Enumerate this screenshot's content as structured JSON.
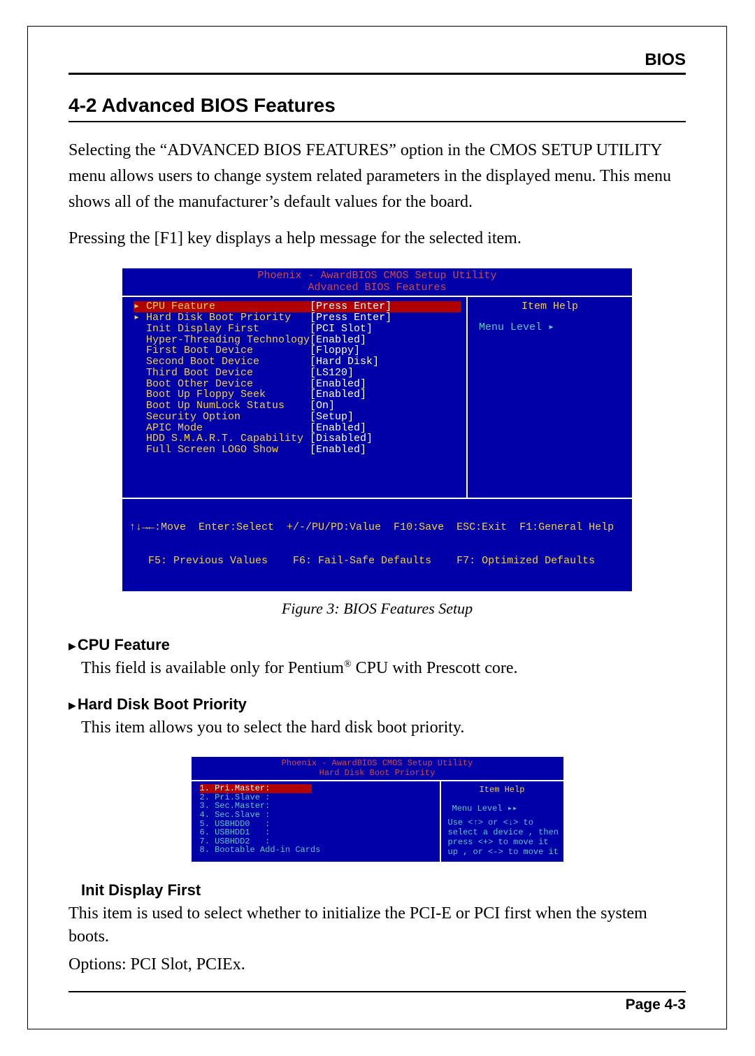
{
  "header": {
    "label": "BIOS"
  },
  "section": {
    "title": "4-2 Advanced BIOS Features"
  },
  "intro": {
    "p1": "Selecting the “ADVANCED BIOS FEATURES” option in the CMOS SETUP UTILITY menu allows users to change system related parameters in the displayed menu. This menu shows all  of the manufacturer’s default values for the board.",
    "p2": "Pressing the [F1] key displays a help message for the selected item."
  },
  "bios1": {
    "title": "Phoenix - AwardBIOS CMOS Setup Utility",
    "subtitle": "Advanced BIOS Features",
    "rows": [
      {
        "pre": "▸ ",
        "label": "CPU Feature",
        "value": "[Press Enter]",
        "selected": true
      },
      {
        "pre": "▸ ",
        "label": "Hard Disk Boot Priority",
        "value": "[Press Enter]"
      },
      {
        "pre": "  ",
        "label": "Init Display First",
        "value": "[PCI Slot]"
      },
      {
        "pre": "  ",
        "label": "Hyper-Threading Technology",
        "value": "[Enabled]"
      },
      {
        "pre": "  ",
        "label": "First Boot Device",
        "value": "[Floppy]"
      },
      {
        "pre": "  ",
        "label": "Second Boot Device",
        "value": "[Hard Disk]"
      },
      {
        "pre": "  ",
        "label": "Third Boot Device",
        "value": "[LS120]"
      },
      {
        "pre": "  ",
        "label": "Boot Other Device",
        "value": "[Enabled]"
      },
      {
        "pre": "  ",
        "label": "Boot Up Floppy Seek",
        "value": "[Enabled]"
      },
      {
        "pre": "  ",
        "label": "Boot Up NumLock Status",
        "value": "[On]"
      },
      {
        "pre": "  ",
        "label": "Security Option",
        "value": "[Setup]"
      },
      {
        "pre": "  ",
        "label": "APIC Mode",
        "value": "[Enabled]"
      },
      {
        "pre": "  ",
        "label": "HDD S.M.A.R.T. Capability",
        "value": "[Disabled]"
      },
      {
        "pre": "  ",
        "label": "Full Screen LOGO Show",
        "value": "[Enabled]"
      }
    ],
    "right": {
      "item_help": "Item Help",
      "menu_level": "Menu Level   ▸"
    },
    "footer": {
      "l1": "↑↓→←:Move  Enter:Select  +/-/PU/PD:Value  F10:Save  ESC:Exit  F1:General Help",
      "l2": "   F5: Previous Values    F6: Fail-Safe Defaults    F7: Optimized Defaults"
    }
  },
  "figure": {
    "caption": "Figure 3:  BIOS Features Setup"
  },
  "items": {
    "cpu_feature": {
      "title": "CPU Feature",
      "text_pre": "This field is available only for Pentium",
      "text_post": " CPU with Prescott core."
    },
    "hd_boot": {
      "title": "Hard Disk Boot Priority",
      "text": "This item allows you to select the hard disk boot priority."
    },
    "init_display": {
      "title": "Init Display First",
      "text": "This item is used to select whether to initialize the PCI-E or PCI first when the system boots.",
      "options": "Options: PCI Slot, PCIEx."
    }
  },
  "bios2": {
    "title": "Phoenix - AwardBIOS CMOS Setup Utility",
    "subtitle": "Hard Disk Boot Priority",
    "rows": [
      {
        "n": "1.",
        "label": "Pri.Master:",
        "selected": true
      },
      {
        "n": "2.",
        "label": "Pri.Slave :"
      },
      {
        "n": "3.",
        "label": "Sec.Master:"
      },
      {
        "n": "4.",
        "label": "Sec.Slave :"
      },
      {
        "n": "5.",
        "label": "USBHDD0   :"
      },
      {
        "n": "6.",
        "label": "USBHDD1   :"
      },
      {
        "n": "7.",
        "label": "USBHDD2   :"
      },
      {
        "n": "8.",
        "label": "Bootable Add-in Cards"
      }
    ],
    "right": {
      "item_help": "Item Help",
      "menu_level": "Menu Level   ▸▸",
      "help": "Use <↑> or <↓> to\nselect a device , then\npress <+> to move it\nup , or <-> to move it"
    }
  },
  "footer": {
    "page": "Page 4-3"
  },
  "glyphs": {
    "tri": "▶",
    "reg": "®"
  }
}
